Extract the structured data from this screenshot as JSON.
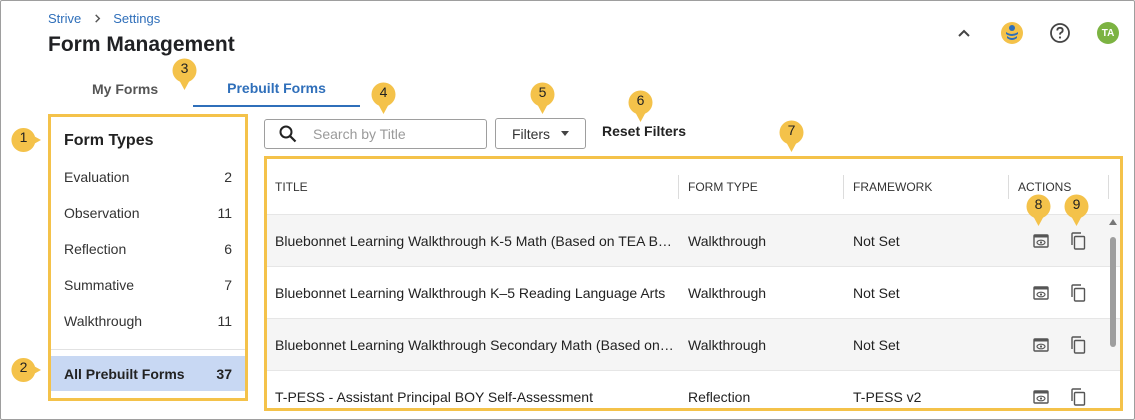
{
  "breadcrumb": {
    "root": "Strive",
    "current": "Settings"
  },
  "page_title": "Form Management",
  "header_icons": [
    "chevron-up-icon",
    "strive-logo-icon",
    "help-icon"
  ],
  "user": {
    "initials": "TA"
  },
  "tabs": [
    {
      "label": "My Forms",
      "active": false
    },
    {
      "label": "Prebuilt Forms",
      "active": true
    }
  ],
  "sidebar": {
    "title": "Form Types",
    "items": [
      {
        "label": "Evaluation",
        "count": "2"
      },
      {
        "label": "Observation",
        "count": "11"
      },
      {
        "label": "Reflection",
        "count": "6"
      },
      {
        "label": "Summative",
        "count": "7"
      },
      {
        "label": "Walkthrough",
        "count": "11"
      }
    ],
    "all": {
      "label": "All Prebuilt Forms",
      "count": "37"
    }
  },
  "search": {
    "placeholder": "Search by Title",
    "value": ""
  },
  "filters_label": "Filters",
  "reset_label": "Reset Filters",
  "table": {
    "headers": [
      "TITLE",
      "FORM TYPE",
      "FRAMEWORK",
      "ACTIONS"
    ],
    "rows": [
      {
        "title": "Bluebonnet Learning Walkthrough K-5 Math (Based on TEA B…",
        "type": "Walkthrough",
        "framework": "Not Set"
      },
      {
        "title": "Bluebonnet Learning Walkthrough K–5 Reading Language Arts",
        "type": "Walkthrough",
        "framework": "Not Set"
      },
      {
        "title": "Bluebonnet Learning Walkthrough Secondary Math (Based on…",
        "type": "Walkthrough",
        "framework": "Not Set"
      },
      {
        "title": "T-PESS - Assistant Principal BOY Self-Assessment",
        "type": "Reflection",
        "framework": "T-PESS v2"
      }
    ]
  },
  "callouts": [
    "1",
    "2",
    "3",
    "4",
    "5",
    "6",
    "7",
    "8",
    "9"
  ],
  "colors": {
    "accent": "#2f6fba",
    "callout": "#f4c24a",
    "selected": "#c8d8f3",
    "avatar": "#7cb342"
  }
}
